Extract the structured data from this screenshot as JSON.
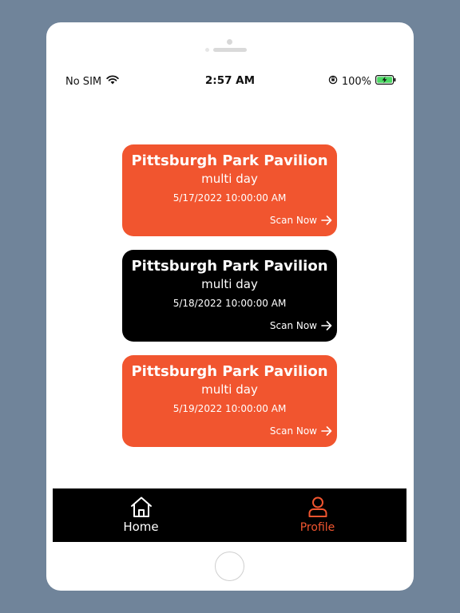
{
  "status_bar": {
    "carrier": "No SIM",
    "time": "2:57 AM",
    "battery": "100%"
  },
  "cards": [
    {
      "title": "Pittsburgh Park Pavilion",
      "subtitle": "multi day",
      "date": "5/17/2022 10:00:00 AM",
      "action": "Scan Now",
      "color": "#f1552f"
    },
    {
      "title": "Pittsburgh Park Pavilion",
      "subtitle": "multi day",
      "date": "5/18/2022 10:00:00 AM",
      "action": "Scan Now",
      "color": "#000000"
    },
    {
      "title": "Pittsburgh Park Pavilion",
      "subtitle": "multi day",
      "date": "5/19/2022 10:00:00 AM",
      "action": "Scan Now",
      "color": "#f1552f"
    }
  ],
  "tabs": [
    {
      "label": "Home",
      "icon": "home-icon",
      "color": "#ffffff"
    },
    {
      "label": "Profile",
      "icon": "person-icon",
      "color": "#f1552f",
      "active": true
    }
  ],
  "colors": {
    "accent": "#f1552f",
    "background": "#70849a"
  }
}
